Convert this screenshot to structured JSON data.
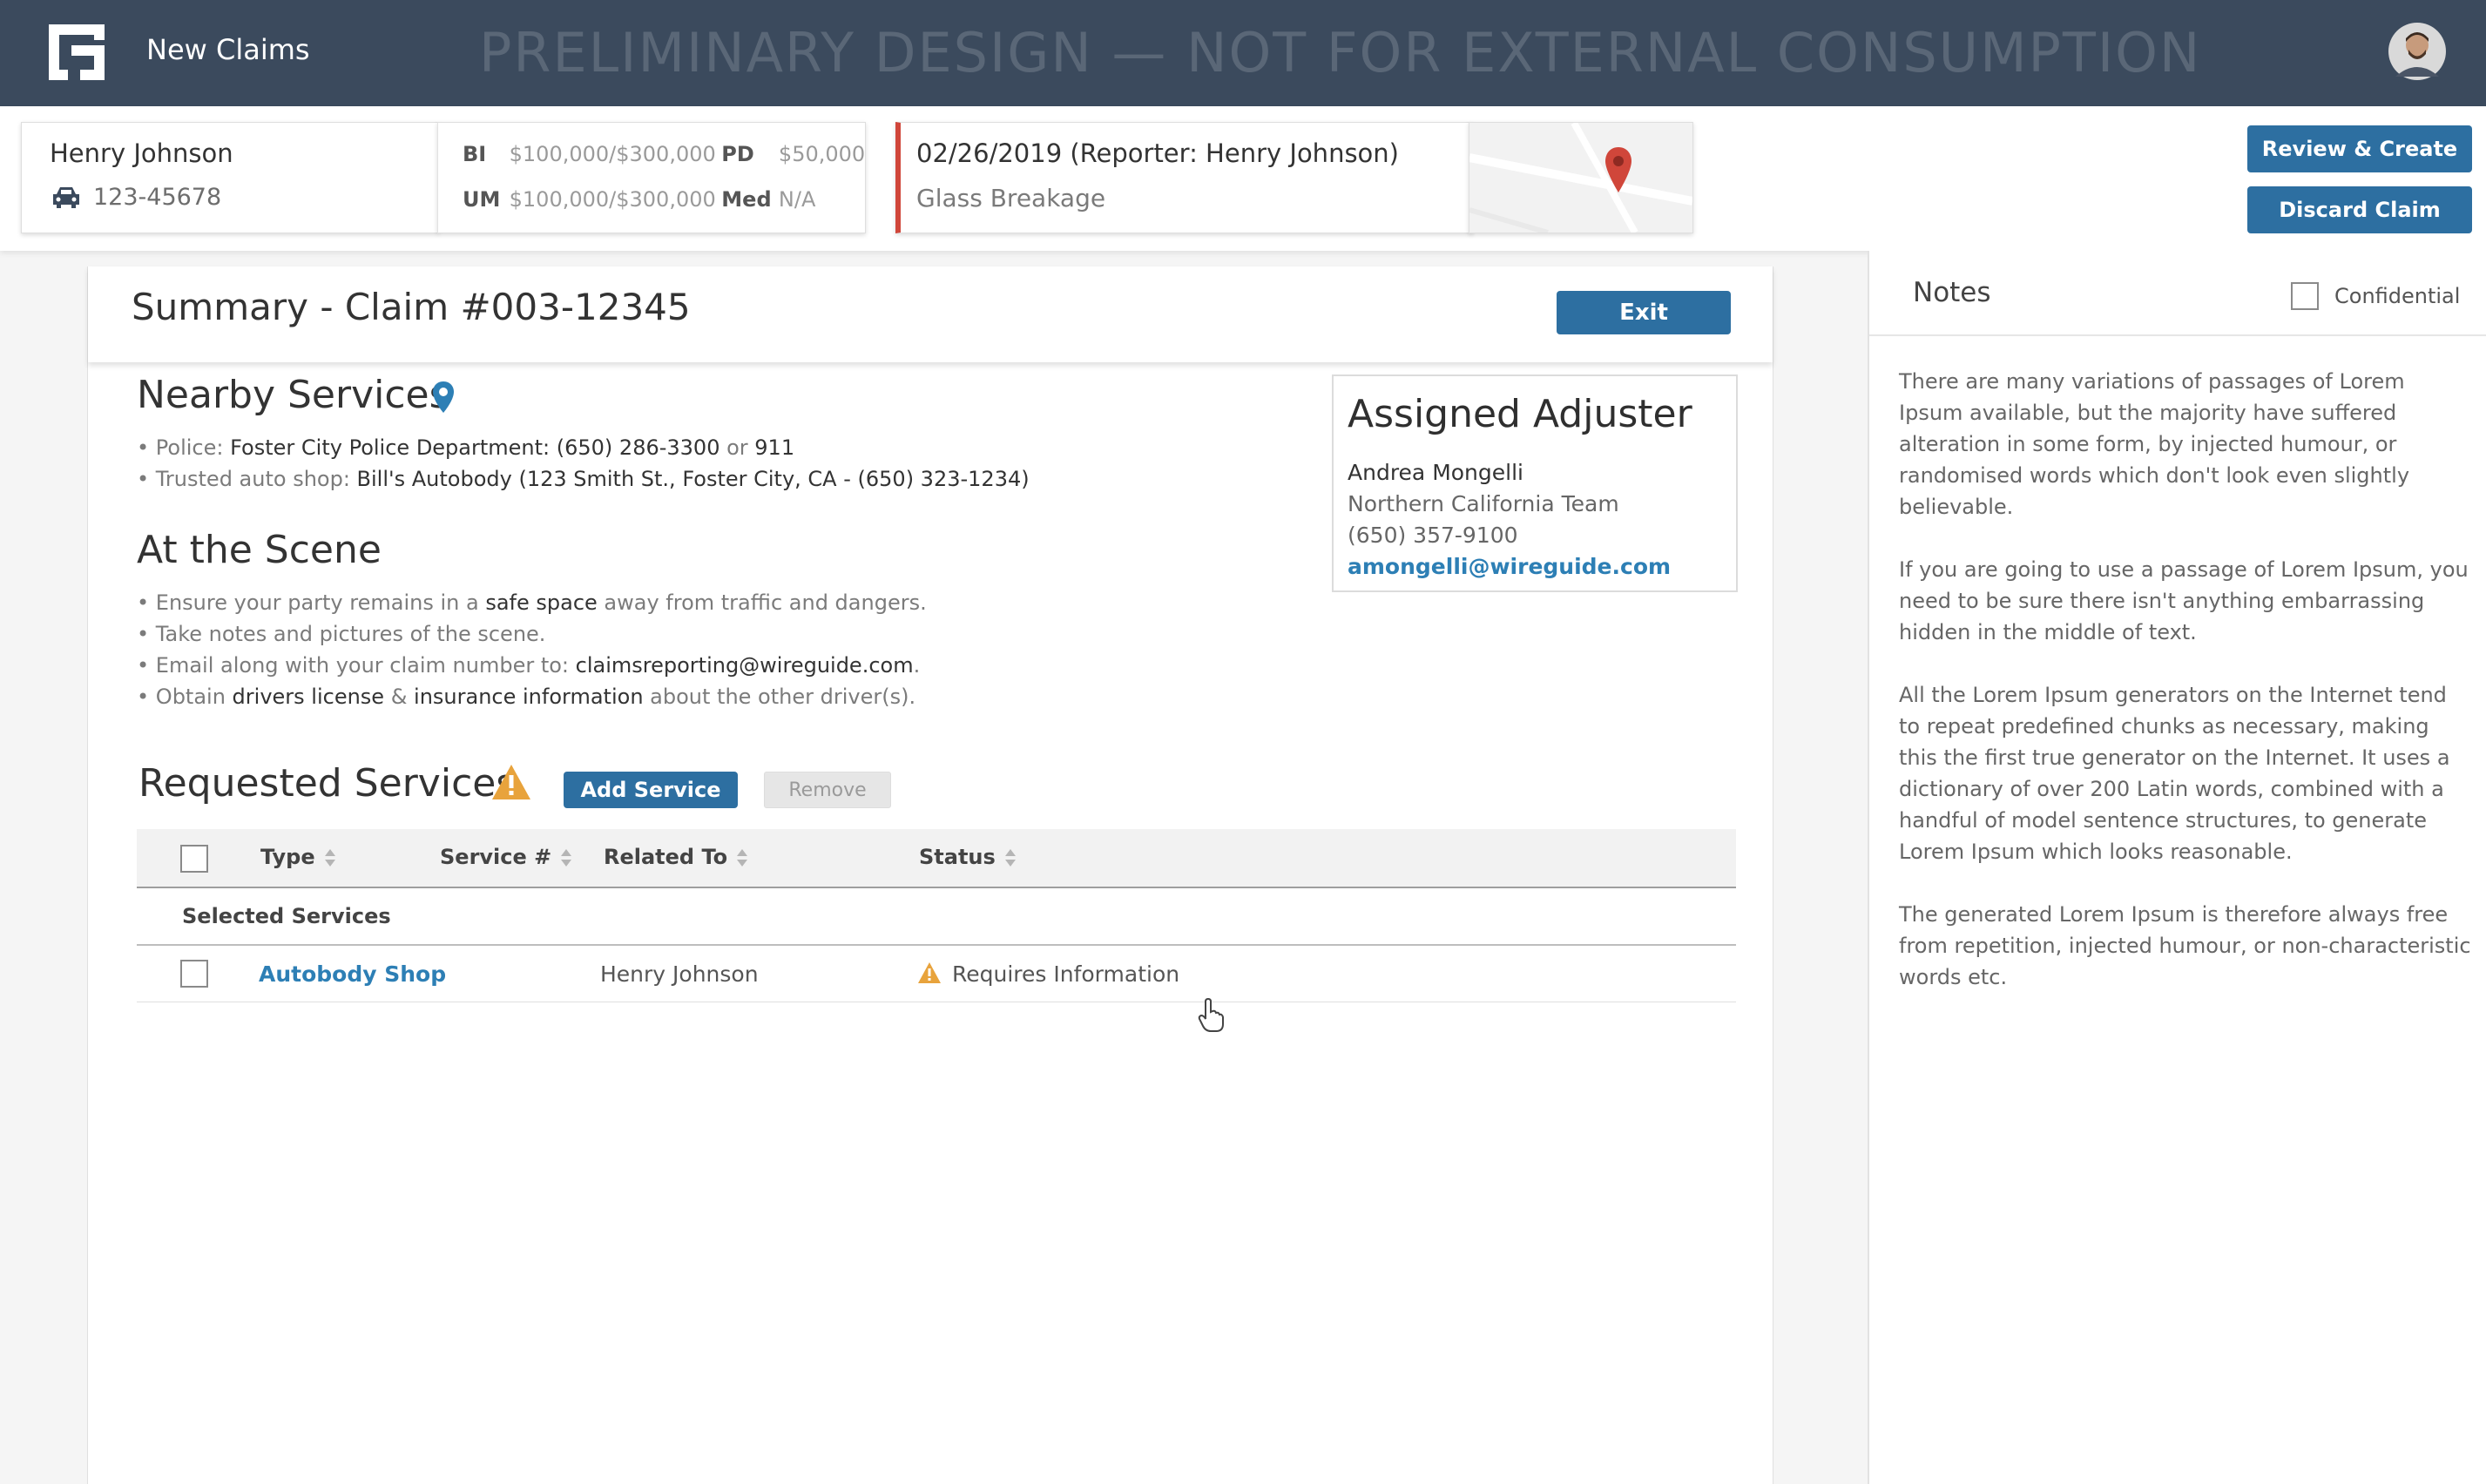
{
  "nav": {
    "app_title": "New Claims",
    "watermark": "PRELIMINARY DESIGN — NOT FOR EXTERNAL CONSUMPTION"
  },
  "header": {
    "insured": {
      "name": "Henry Johnson",
      "policy": "123-45678"
    },
    "coverage": {
      "bi_label": "BI",
      "bi_value": "$100,000/$300,000",
      "pd_label": "PD",
      "pd_value": "$50,000",
      "um_label": "UM",
      "um_value": "$100,000/$300,000",
      "med_label": "Med",
      "med_value": "N/A"
    },
    "claim": {
      "date_reporter": "02/26/2019 (Reporter: Henry Johnson)",
      "type": "Glass Breakage"
    },
    "review_label": "Review & Create",
    "discard_label": "Discard Claim"
  },
  "summary": {
    "title": "Summary - Claim #003-12345",
    "exit_label": "Exit"
  },
  "nearby": {
    "heading": "Nearby Services",
    "police_prefix": "Police: ",
    "police_name": "Foster City Police Department: (650) 286-3300",
    "police_or": " or ",
    "police_emergency": "911",
    "shop_prefix": "Trusted auto shop: ",
    "shop_name": "Bill's Autobody (123 Smith St., Foster City, CA - (650) 323-1234)"
  },
  "scene": {
    "heading": "At the Scene",
    "b1_pre": "Ensure your party remains in a ",
    "b1_bold": "safe space",
    "b1_post": " away from traffic and dangers.",
    "b2": "Take notes and pictures of the scene.",
    "b3_pre": "Email along with your claim number to: ",
    "b3_bold": "claimsreporting@wireguide.com",
    "b3_post": ".",
    "b4_pre": "Obtain ",
    "b4_bold1": "drivers license",
    "b4_mid": " & ",
    "b4_bold2": "insurance information",
    "b4_post": " about the other driver(s)."
  },
  "adjuster": {
    "heading": "Assigned Adjuster",
    "name": "Andrea Mongelli",
    "team": "Northern California Team",
    "phone": "(650) 357-9100",
    "email": "amongelli@wireguide.com"
  },
  "requested": {
    "heading": "Requested Services",
    "add_label": "Add Service",
    "remove_label": "Remove",
    "columns": [
      "Type",
      "Service #",
      "Related To",
      "Status"
    ],
    "group_label": "Selected Services",
    "rows": [
      {
        "type": "Autobody Shop",
        "service_num": "",
        "related_to": "Henry Johnson",
        "status": "Requires Information"
      }
    ]
  },
  "notes": {
    "title": "Notes",
    "confidential_label": "Confidential",
    "paragraphs": [
      "There are many variations of passages of Lorem Ipsum available, but the majority have suffered alteration in some form, by injected humour, or randomised words which don't look even slightly believable.",
      "If you are going to use a passage of Lorem Ipsum, you need to be sure there isn't anything embarrassing hidden in the middle of text.",
      "All the Lorem Ipsum generators on the Internet tend to repeat predefined chunks as necessary, making this the first true generator on the Internet. It uses a dictionary of over 200 Latin words, combined with a handful of model sentence structures, to generate Lorem Ipsum which looks reasonable.",
      "The generated Lorem Ipsum is therefore always free from repetition, injected humour, or non-characteristic words etc."
    ]
  },
  "icons": {
    "logo": "logo-icon",
    "avatar": "avatar",
    "car": "car-icon",
    "map_pin": "map-pin-icon",
    "location": "location-pin-icon",
    "warning": "warning-icon",
    "sort": "sort-icon",
    "cursor": "hand-cursor-icon"
  },
  "colors": {
    "nav_bg": "#3b4a5d",
    "primary": "#2d6fa1",
    "link": "#2d7fb5",
    "claim_accent": "#d0463a",
    "warning": "#e8a33c"
  }
}
